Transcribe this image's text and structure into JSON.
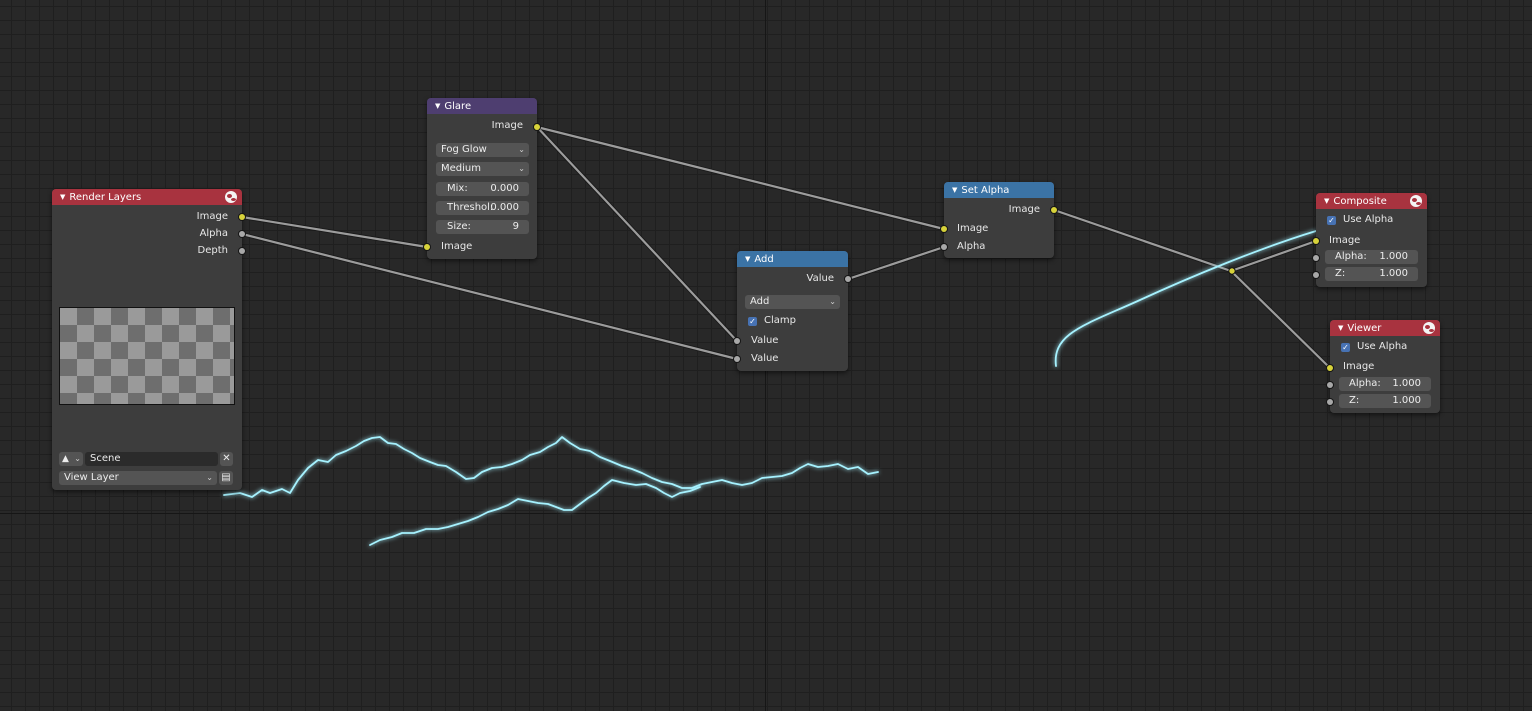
{
  "nodes": {
    "render_layers": {
      "title": "Render Layers",
      "outputs": [
        "Image",
        "Alpha",
        "Depth"
      ],
      "scene": "Scene",
      "view_layer": "View Layer"
    },
    "glare": {
      "title": "Glare",
      "output": "Image",
      "glare_type": "Fog Glow",
      "quality": "Medium",
      "mix_label": "Mix:",
      "mix_value": "0.000",
      "threshold_label": "Threshol:",
      "threshold_value": "0.000",
      "size_label": "Size:",
      "size_value": "9",
      "input": "Image"
    },
    "add": {
      "title": "Add",
      "output": "Value",
      "operation": "Add",
      "clamp_label": "Clamp",
      "inputs": [
        "Value",
        "Value"
      ]
    },
    "set_alpha": {
      "title": "Set Alpha",
      "output": "Image",
      "inputs": [
        "Image",
        "Alpha"
      ]
    },
    "composite": {
      "title": "Composite",
      "use_alpha_label": "Use Alpha",
      "image_label": "Image",
      "alpha_label": "Alpha:",
      "alpha_value": "1.000",
      "z_label": "Z:",
      "z_value": "1.000"
    },
    "viewer": {
      "title": "Viewer",
      "use_alpha_label": "Use Alpha",
      "image_label": "Image",
      "alpha_label": "Alpha:",
      "alpha_value": "1.000",
      "z_label": "Z:",
      "z_value": "1.000"
    }
  },
  "icons": {
    "collapse": "triangle-down-icon",
    "render": "globe-icon",
    "dropdown": "chevron-down-icon",
    "scene": "scene-icon",
    "clear": "x-icon",
    "view_layer_browse": "view-layer-icon",
    "check": "checkmark-icon"
  },
  "colors": {
    "background": "#282828",
    "grid": "#1f1f1f",
    "node_body": "#3d3d3d",
    "header_output": "#a8333f",
    "header_filter": "#4e3e70",
    "header_converter": "#3b73a5",
    "socket_image": "#d7d23a",
    "socket_value": "#a8a8a8",
    "link": "#9c9c9c",
    "lightning": "#a6f2ff",
    "checkbox": "#4772b3"
  }
}
